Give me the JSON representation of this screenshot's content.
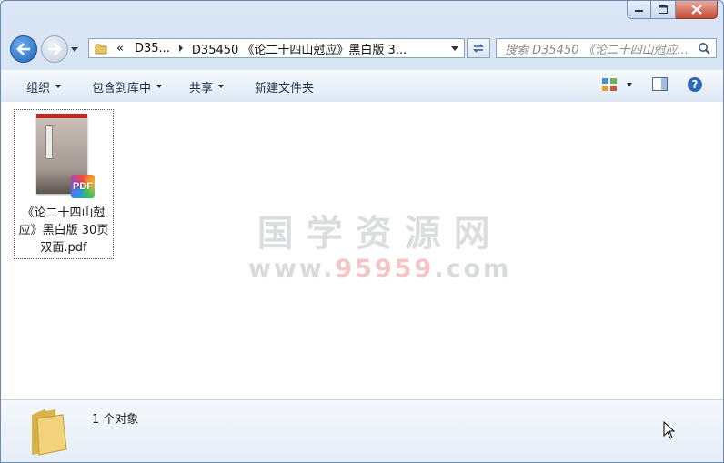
{
  "address": {
    "crumbs": [
      "«",
      "D35...",
      "D35450 《论二十四山尅应》黑白版 3..."
    ]
  },
  "search": {
    "placeholder": "搜索 D35450 《论二十四山尅应..."
  },
  "toolbar": {
    "organize": "组织",
    "include_library": "包含到库中",
    "share": "共享",
    "new_folder": "新建文件夹"
  },
  "file": {
    "name": "《论二十四山尅应》黑白版 30页双面.pdf",
    "badge": "PDF",
    "thumb_label": "PDF"
  },
  "watermark": {
    "title": "国学资源网",
    "url_prefix": "www.",
    "url_highlight": "95959",
    "url_suffix": ".com"
  },
  "status": {
    "count_text": "1 个对象"
  },
  "colors": {
    "accent": "#1e5fb8",
    "close": "#c74a36",
    "pdf_red": "#c42a23"
  }
}
